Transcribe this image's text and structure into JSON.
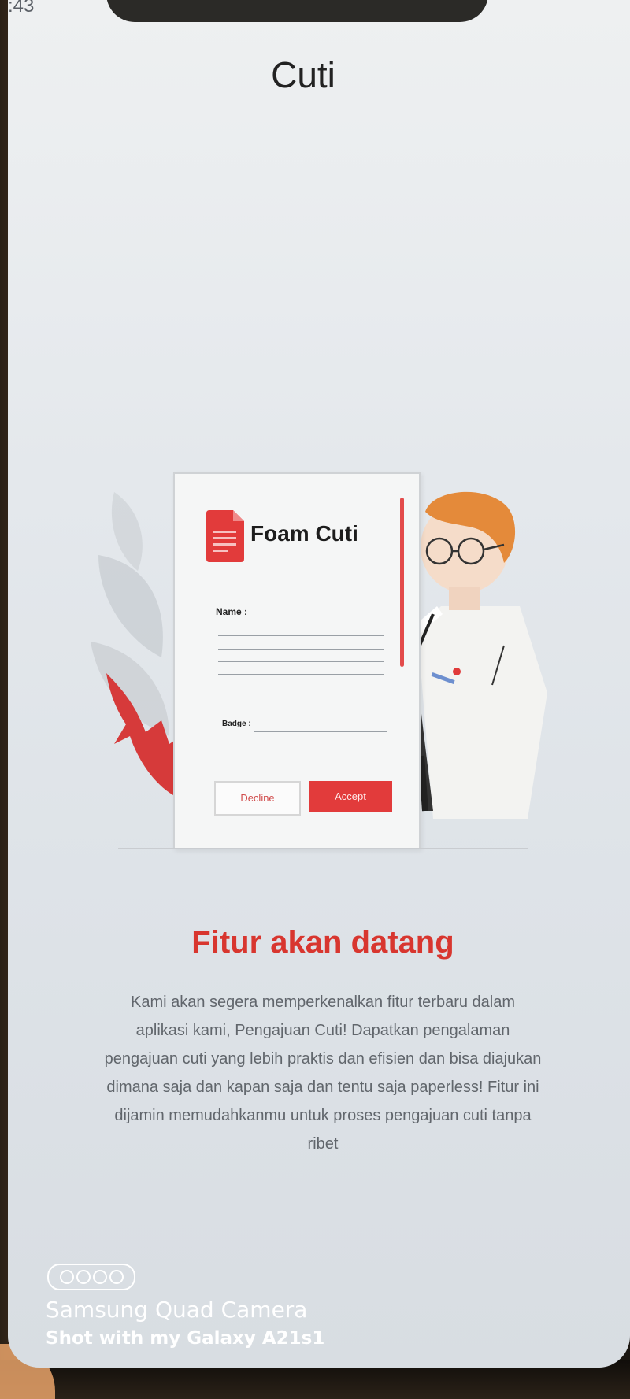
{
  "status_bar": {
    "time": ":43"
  },
  "page": {
    "title": "Cuti"
  },
  "form": {
    "title": "Foam Cuti",
    "name_label": "Name :",
    "badge_label": "Badge :",
    "decline_label": "Decline",
    "accept_label": "Accept"
  },
  "content": {
    "heading": "Fitur akan datang",
    "description": "Kami akan segera memperkenalkan fitur terbaru dalam aplikasi kami, Pengajuan Cuti! Dapatkan pengalaman pengajuan cuti yang lebih praktis dan efisien dan bisa diajukan dimana saja dan kapan saja dan tentu saja paperless! Fitur ini dijamin memudahkanmu untuk proses pengajuan cuti tanpa ribet"
  },
  "camera_watermark": {
    "title": "Samsung Quad Camera",
    "subtitle": "Shot with my Galaxy A21s1"
  },
  "colors": {
    "accent": "#e23b3b",
    "heading": "#d8362f",
    "hair": "#e48a3a"
  },
  "icons": [
    "document-icon",
    "leaf-illustration",
    "person-illustration",
    "camera-lens-icon"
  ]
}
